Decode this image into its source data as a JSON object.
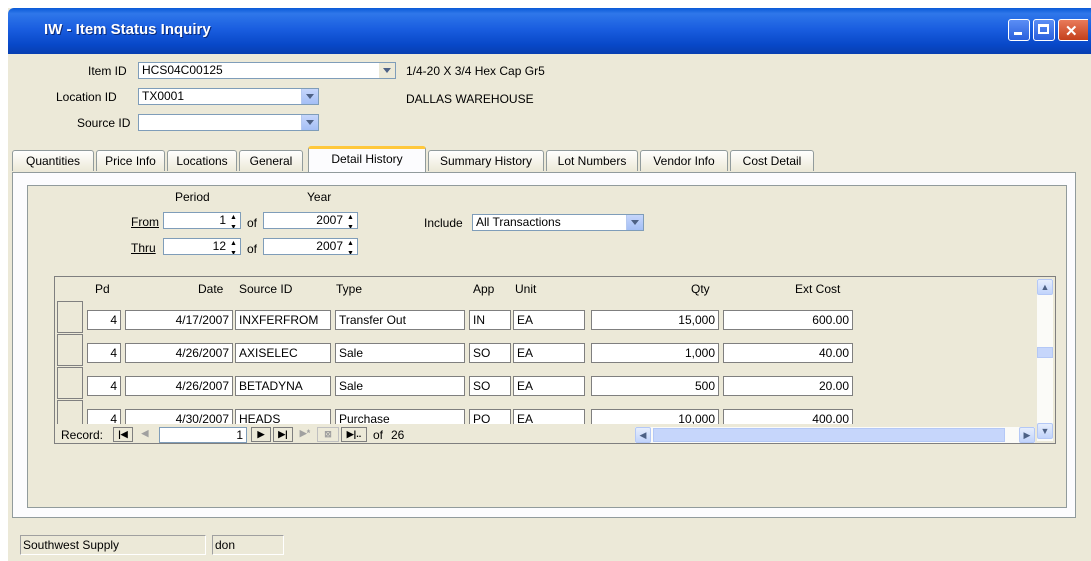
{
  "window": {
    "title": "IW - Item Status Inquiry"
  },
  "controls": {
    "min_icon": "minimize-icon",
    "max_icon": "maximize-icon",
    "close_glyph": "✕"
  },
  "header": {
    "item_id_label": "Item ID",
    "item_id_value": "HCS04C00125",
    "item_desc": "1/4-20 X 3/4 Hex Cap Gr5",
    "location_id_label": "Location ID",
    "location_id_value": "TX0001",
    "location_desc": "DALLAS WAREHOUSE",
    "source_id_label": "Source ID",
    "source_id_value": ""
  },
  "tabs": [
    {
      "label": "Quantities"
    },
    {
      "label": "Price Info"
    },
    {
      "label": "Locations"
    },
    {
      "label": "General"
    },
    {
      "label": "Detail History"
    },
    {
      "label": "Summary History"
    },
    {
      "label": "Lot Numbers"
    },
    {
      "label": "Vendor Info"
    },
    {
      "label": "Cost Detail"
    }
  ],
  "active_tab": "Detail History",
  "filters": {
    "period_label": "Period",
    "year_label": "Year",
    "from_label": "From",
    "thru_label": "Thru",
    "of_label": "of",
    "from_period": "1",
    "from_year": "2007",
    "thru_period": "12",
    "thru_year": "2007",
    "include_label": "Include",
    "include_value": "All Transactions"
  },
  "grid": {
    "columns": [
      "Pd",
      "Date",
      "Source ID",
      "Type",
      "App",
      "Unit",
      "Qty",
      "Ext Cost"
    ],
    "rows": [
      {
        "pd": "4",
        "date": "4/17/2007",
        "source_id": "INXFERFROM",
        "type": "Transfer Out",
        "app": "IN",
        "unit": "EA",
        "qty": "15,000",
        "ext_cost": "600.00"
      },
      {
        "pd": "4",
        "date": "4/26/2007",
        "source_id": "AXISELEC",
        "type": "Sale",
        "app": "SO",
        "unit": "EA",
        "qty": "1,000",
        "ext_cost": "40.00"
      },
      {
        "pd": "4",
        "date": "4/26/2007",
        "source_id": "BETADYNA",
        "type": "Sale",
        "app": "SO",
        "unit": "EA",
        "qty": "500",
        "ext_cost": "20.00"
      },
      {
        "pd": "4",
        "date": "4/30/2007",
        "source_id": "HEADS",
        "type": "Purchase",
        "app": "PO",
        "unit": "EA",
        "qty": "10,000",
        "ext_cost": "400.00"
      }
    ]
  },
  "navigator": {
    "record_label": "Record:",
    "current": "1",
    "of_label": "of",
    "total": "26"
  },
  "statusbar": {
    "company": "Southwest Supply",
    "user": "don"
  }
}
